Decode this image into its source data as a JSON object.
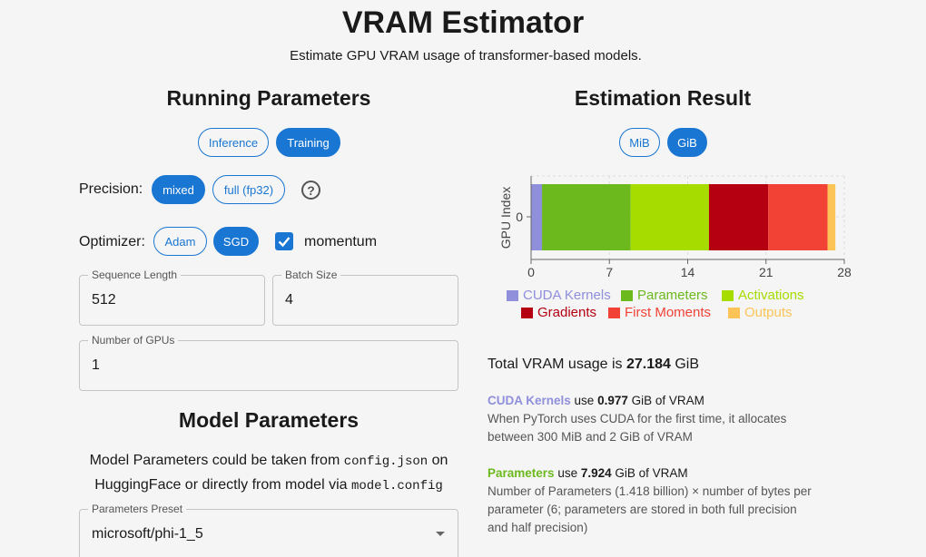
{
  "header": {
    "title": "VRAM Estimator",
    "subtitle": "Estimate GPU VRAM usage of transformer-based models."
  },
  "running": {
    "title": "Running Parameters",
    "mode_options": [
      "Inference",
      "Training"
    ],
    "mode_selected": "Training",
    "precision_label": "Precision:",
    "precision_options": [
      "mixed",
      "full (fp32)"
    ],
    "precision_selected": "mixed",
    "help_icon_glyph": "?",
    "optimizer_label": "Optimizer:",
    "optimizer_options": [
      "Adam",
      "SGD"
    ],
    "optimizer_selected": "SGD",
    "momentum_label": "momentum",
    "momentum_checked": true,
    "seq_len_label": "Sequence Length",
    "seq_len_value": "512",
    "batch_label": "Batch Size",
    "batch_value": "4",
    "gpus_label": "Number of GPUs",
    "gpus_value": "1"
  },
  "model": {
    "title": "Model Parameters",
    "desc_line1_a": "Model Parameters could be taken from ",
    "desc_line1_code": "config.json",
    "desc_line1_b": " on",
    "desc_line2_a": "HuggingFace or directly from model via ",
    "desc_line2_code": "model.config",
    "preset_label": "Parameters Preset",
    "preset_value": "microsoft/phi-1_5"
  },
  "result": {
    "title": "Estimation Result",
    "unit_options": [
      "MiB",
      "GiB"
    ],
    "unit_selected": "GiB",
    "total_prefix": "Total VRAM usage is ",
    "total_value": "27.184",
    "total_unit": " GiB",
    "cuda_name": "CUDA Kernels",
    "cuda_use": " use ",
    "cuda_value": "0.977",
    "cuda_unit": " GiB of VRAM",
    "cuda_desc_1": "When PyTorch uses CUDA for the first time, it allocates",
    "cuda_desc_2": "between 300 MiB and 2 GiB of VRAM",
    "params_name": "Parameters",
    "params_use": " use ",
    "params_value": "7.924",
    "params_unit": " GiB of VRAM",
    "params_desc_1": "Number of Parameters (1.418 billion) × number of bytes per",
    "params_desc_2": "parameter (6; parameters are stored in both full precision",
    "params_desc_3": "and half precision)"
  },
  "colors": {
    "accent": "#1976d2",
    "cuda": "#8f8fdc",
    "parameters": "#6cb91e",
    "activations": "#a6dc00",
    "gradients": "#b40010",
    "first_moments": "#f24236",
    "outputs": "#fcc456"
  },
  "chart_data": {
    "type": "bar",
    "orientation": "horizontal",
    "stacked": true,
    "ylabel": "GPU Index",
    "categories": [
      "0"
    ],
    "xticks": [
      "0",
      "7",
      "14",
      "21",
      "28"
    ],
    "xlim": [
      0,
      28
    ],
    "grid": true,
    "legend_position": "bottom",
    "series": [
      {
        "name": "CUDA Kernels",
        "values": [
          0.977
        ]
      },
      {
        "name": "Parameters",
        "values": [
          7.924
        ]
      },
      {
        "name": "Activations",
        "values": [
          7.0
        ]
      },
      {
        "name": "Gradients",
        "values": [
          5.3
        ]
      },
      {
        "name": "First Moments",
        "values": [
          5.3
        ]
      },
      {
        "name": "Outputs",
        "values": [
          0.7
        ]
      }
    ]
  }
}
